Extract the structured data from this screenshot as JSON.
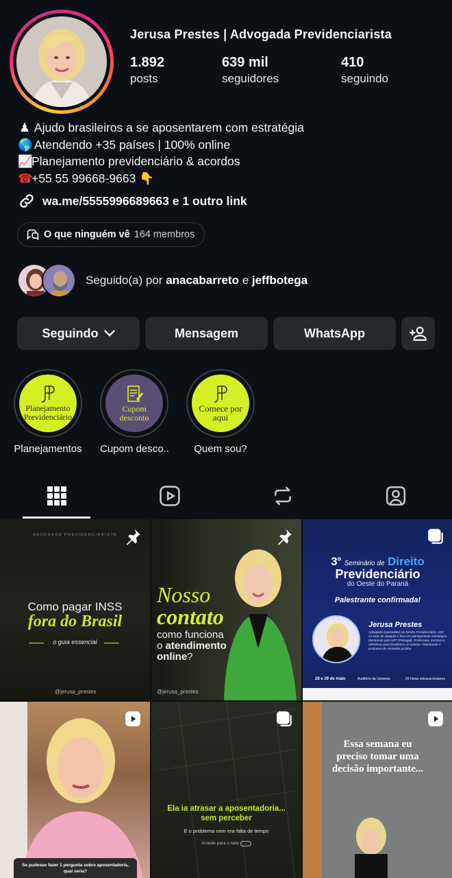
{
  "profile": {
    "name": "Jerusa Prestes | Advogada Previdenciarista",
    "stats": [
      {
        "value": "1.892",
        "label": "posts"
      },
      {
        "value": "639 mil",
        "label": "seguidores"
      },
      {
        "value": "410",
        "label": "seguindo"
      }
    ],
    "bio": [
      {
        "emoji": "♟",
        "text": "Ajudo brasileiros a se aposentarem com estratégia"
      },
      {
        "emoji": "🌎",
        "text": " Atendendo +35 países | 100% online"
      },
      {
        "emoji": "📈",
        "text": "Planejamento previdenciário & acordos"
      },
      {
        "emoji": "☎",
        "text": "+55 55 99668-9663 👇"
      }
    ],
    "link": "wa.me/5555996689663 e 1 outro link"
  },
  "channel": {
    "name": "O que ninguém vê",
    "members": "164 membros"
  },
  "followed_by": {
    "prefix": "Seguido(a) por ",
    "user1": "anacabarreto",
    "joiner": " e ",
    "user2": "jeffbotega"
  },
  "buttons": {
    "following": "Seguindo",
    "message": "Mensagem",
    "whatsapp": "WhatsApp"
  },
  "highlights": [
    {
      "label": "Planejamentos",
      "disc_text": "Planejamento Previdenciário",
      "color": "#d4f024"
    },
    {
      "label": "Cupom desco...",
      "disc_text": "Cupom desconto",
      "color": "#5b4e74"
    },
    {
      "label": "Quem sou?",
      "disc_text": "Comece por aqui",
      "color": "#d4f024"
    }
  ],
  "tabs": [
    "grid-icon",
    "reels-icon",
    "reposts-icon",
    "tagged-icon"
  ],
  "posts": {
    "p1": {
      "kicker": "ADVOGADA PREVIDENCIARISTA",
      "line1": "Como pagar INSS",
      "line2": "fora do Brasil",
      "sub": "o guia essencial",
      "handle": "@jerusa_prestes",
      "badge": "pin-icon"
    },
    "p2": {
      "line1": "Nosso",
      "line2": "contato",
      "line3": "como funciona",
      "line4a": "o ",
      "line4b": "atendimento",
      "line5": "online",
      "line5b": "?",
      "handle": "@jerusa_prestes",
      "badge": "pin-icon"
    },
    "p3": {
      "n": "3",
      "sup": "o",
      "seminar": "Seminário de",
      "direito": "Direito",
      "prev": "Previdenciário",
      "region": "do Oeste do Paraná",
      "confirmed": "Palestrante confirmada!",
      "speaker": "Jerusa Prestes",
      "desc": "Advogada especialista em Direito Previdenciário, com 14 anos de atuação e foco em planejamento estratégico. Mestranda pela UPT (Portugal). Professora, mentora e referência para brasileiros no exterior. Palestrante e produtora de conteúdo jurídico.",
      "dates": "28 e 29 de maio",
      "venue": "Auditório da Unioeste",
      "hours": "20 horas extracurriculares",
      "badge": "carousel-icon"
    },
    "p4": {
      "caption": "Se pudesse fazer 1 pergunta sobre aposentadoria, qual seria?",
      "badge": "reel-icon"
    },
    "p5": {
      "line1": "Ela ia atrasar a aposentadoria...",
      "line2": "sem perceber",
      "line3": "E o problema nem era falta de tempo",
      "line4": "Arraste para o lado",
      "badge": "carousel-icon"
    },
    "p6": {
      "line1": "Essa semana eu",
      "line2": "preciso tomar uma",
      "line3": "decisão importante...",
      "badge": "reel-icon"
    }
  },
  "colors": {
    "accent_green": "#c6e82a",
    "bg": "#0c1014",
    "button": "#25292e",
    "seminar_blue": "#182a78"
  }
}
